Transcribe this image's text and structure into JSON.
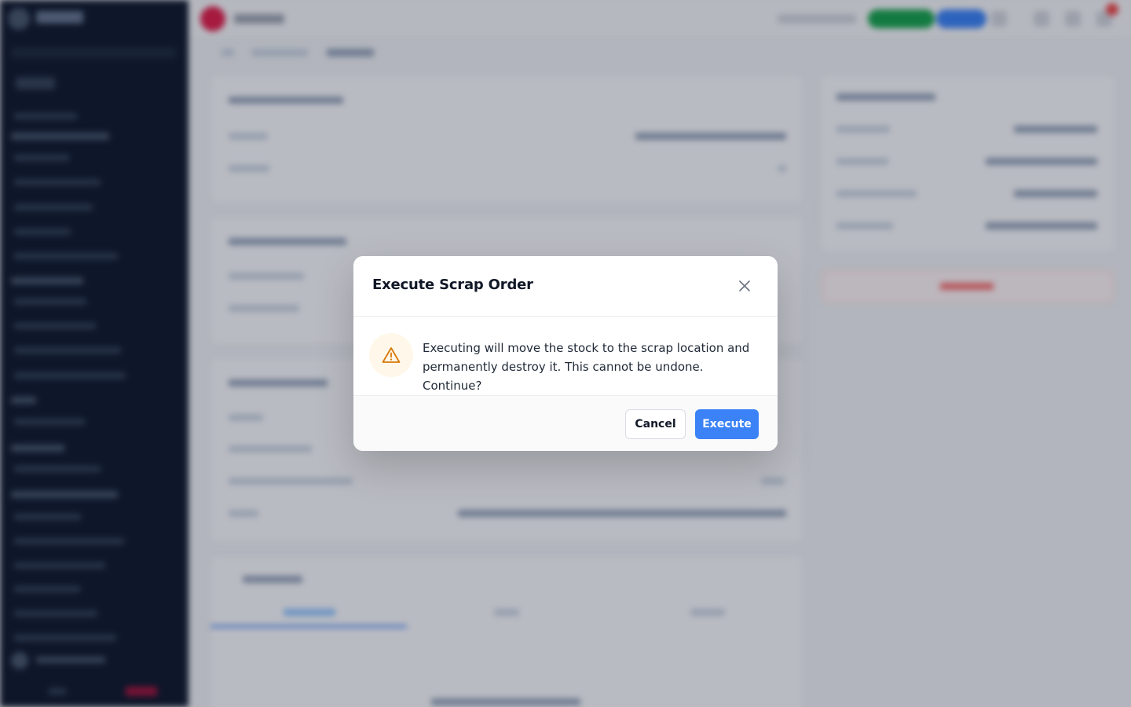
{
  "modal": {
    "title": "Execute Scrap Order",
    "message": "Executing will move the stock to the scrap location and permanently destroy it. This cannot be undone. Continue?",
    "cancel_label": "Cancel",
    "execute_label": "Execute",
    "icons": {
      "close": "close-icon",
      "warning": "warning-icon"
    },
    "colors": {
      "primary": "#3b82f6",
      "warning": "#d97706",
      "warning_bg": "#fff8ea"
    }
  }
}
